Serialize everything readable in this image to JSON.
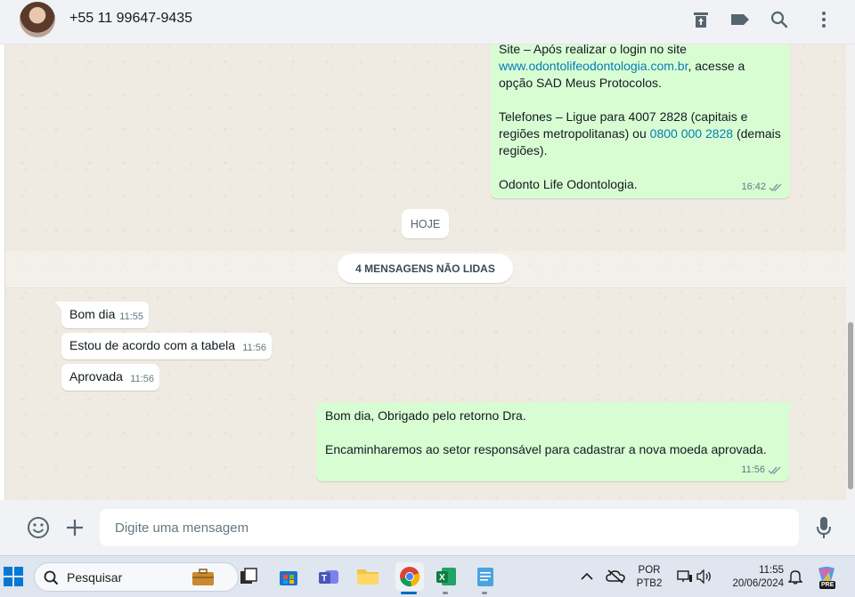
{
  "header": {
    "contact_name": "+55 11 99647-9435",
    "icons": [
      "archive-icon",
      "label-icon",
      "search-icon",
      "more-vert-icon"
    ]
  },
  "messages": {
    "top_outgoing": {
      "line1": "Site – Após realizar o login no site",
      "link1": "www.odontolifeodontologia.com.br",
      "line2_suffix": ", acesse a",
      "line3": "opção SAD Meus Protocolos.",
      "phones_prefix": "Telefones – Ligue para 4007 2828 (capitais e",
      "phones_line2_prefix": "regiões metropolitanas) ou ",
      "phone_link": "0800 000 2828",
      "phones_line2_suffix": " (demais",
      "phones_line3": "regiões).",
      "signature": "Odonto Life Odontologia.",
      "time": "16:42"
    },
    "date_divider": "HOJE",
    "unread_divider": "4 MENSAGENS NÃO LIDAS",
    "incoming": [
      {
        "text": "Bom dia",
        "time": "11:55"
      },
      {
        "text": "Estou de acordo com a tabela",
        "time": "11:56"
      },
      {
        "text": "Aprovada",
        "time": "11:56"
      }
    ],
    "reply": {
      "line1": "Bom dia, Obrigado pelo retorno Dra.",
      "line2": "Encaminharemos ao setor responsável para cadastrar a nova moeda aprovada.",
      "time": "11:56"
    }
  },
  "composer": {
    "placeholder": "Digite uma mensagem"
  },
  "taskbar": {
    "search_placeholder": "Pesquisar",
    "language": "POR",
    "layout": "PTB2",
    "time": "11:55",
    "date": "20/06/2024",
    "pre_badge": "PRE"
  },
  "colors": {
    "outgoing_bubble": "#d9fdd3",
    "incoming_bubble": "#ffffff",
    "link": "#027eb5",
    "chat_bg": "#efeae2",
    "read_ticks": "#8696a0"
  }
}
